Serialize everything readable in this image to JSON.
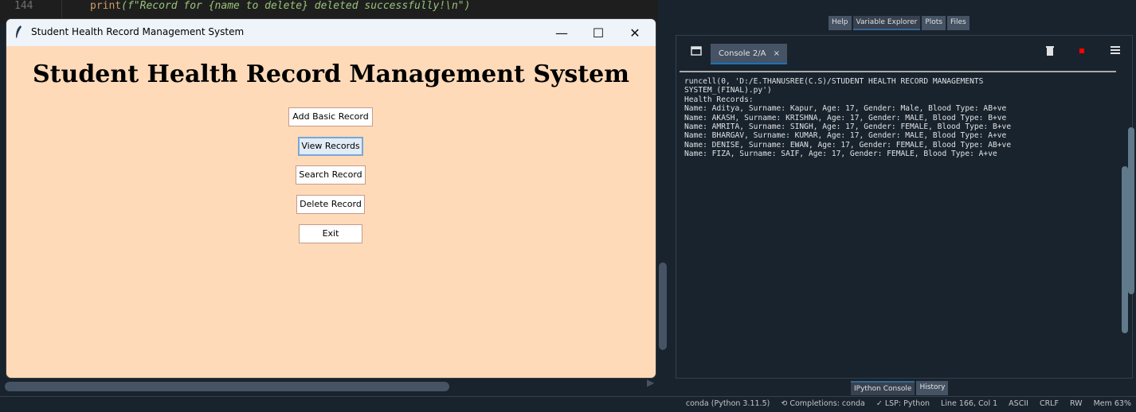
{
  "editor": {
    "line_number": "144",
    "code_print": "print",
    "code_string": "(f\"Record for {name to delete} deleted successfully!\\n\")"
  },
  "tk_window": {
    "title": "Student Health Record Management System",
    "heading": "Student Health Record Management System",
    "controls": {
      "minimize": "—",
      "maximize": "☐",
      "close": "✕"
    },
    "buttons": {
      "add": "Add Basic Record",
      "view": "View Records",
      "search": "Search Record",
      "delete": "Delete Record",
      "exit": "Exit"
    },
    "background_color": "#ffdab9"
  },
  "right_panel": {
    "top_tabs": [
      "Help",
      "Variable Explorer",
      "Plots",
      "Files"
    ],
    "console_tab_label": "Console 2/A",
    "console_tab_close": "×",
    "bottom_tabs": [
      "IPython Console",
      "History"
    ],
    "console_lines": [
      "runcell(0, 'D:/E.THANUSREE(C.S)/STUDENT HEALTH RECORD MANAGEMENTS",
      "SYSTEM_(FINAL).py')",
      "Health Records:",
      "Name: Aditya, Surname: Kapur, Age: 17, Gender: Male, Blood Type: AB+ve",
      "Name: AKASH, Surname: KRISHNA, Age: 17, Gender: MALE, Blood Type: B+ve",
      "Name: AMRITA, Surname: SINGH, Age: 17, Gender: FEMALE, Blood Type: B+ve",
      "Name: BHARGAV, Surname: KUMAR, Age: 17, Gender: MALE, Blood Type: A+ve",
      "Name: DENISE, Surname: EWAN, Age: 17, Gender: FEMALE, Blood Type: AB+ve",
      "Name: FIZA, Surname: SAIF, Age: 17, Gender: FEMALE, Blood Type: A+ve"
    ],
    "icons": {
      "window": "window-icon",
      "trash": "trash-icon",
      "stop": "stop-icon",
      "menu": "menu-icon"
    }
  },
  "statusbar": {
    "conda": "conda (Python 3.11.5)",
    "completions": "Completions: conda",
    "lsp": "LSP: Python",
    "position": "Line 166, Col 1",
    "encoding": "ASCII",
    "eol": "CRLF",
    "rw": "RW",
    "mem": "Mem 63%"
  },
  "colors": {
    "app_bg": "#19232d",
    "accent": "#346792",
    "stop_red": "#ff0000"
  }
}
